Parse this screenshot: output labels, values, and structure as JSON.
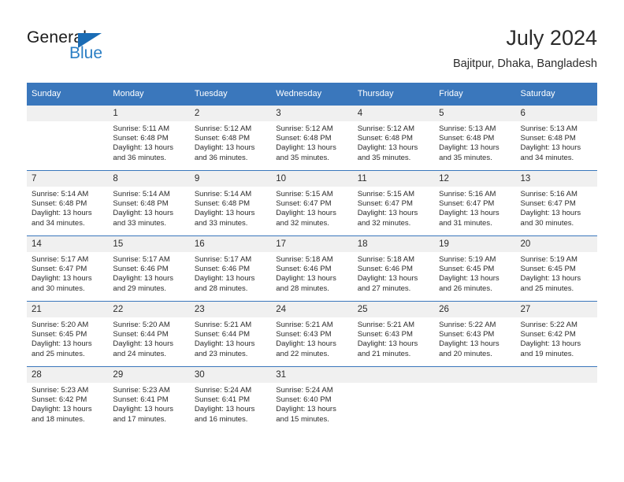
{
  "brand": {
    "name_part1": "General",
    "name_part2": "Blue",
    "triangle_icon": "triangle-icon",
    "accent_color": "#1a6cb5",
    "text_color": "#2a7ec4"
  },
  "header": {
    "title": "July 2024",
    "subtitle": "Bajitpur, Dhaka, Bangladesh"
  },
  "calendar": {
    "header_bg": "#3a77bc",
    "daynum_bg": "#f0f0f0",
    "weekday_headers": [
      "Sunday",
      "Monday",
      "Tuesday",
      "Wednesday",
      "Thursday",
      "Friday",
      "Saturday"
    ],
    "weeks": [
      [
        {
          "day": "",
          "empty": true
        },
        {
          "day": "1",
          "sunrise": "Sunrise: 5:11 AM",
          "sunset": "Sunset: 6:48 PM",
          "daylight_line1": "Daylight: 13 hours",
          "daylight_line2": "and 36 minutes."
        },
        {
          "day": "2",
          "sunrise": "Sunrise: 5:12 AM",
          "sunset": "Sunset: 6:48 PM",
          "daylight_line1": "Daylight: 13 hours",
          "daylight_line2": "and 36 minutes."
        },
        {
          "day": "3",
          "sunrise": "Sunrise: 5:12 AM",
          "sunset": "Sunset: 6:48 PM",
          "daylight_line1": "Daylight: 13 hours",
          "daylight_line2": "and 35 minutes."
        },
        {
          "day": "4",
          "sunrise": "Sunrise: 5:12 AM",
          "sunset": "Sunset: 6:48 PM",
          "daylight_line1": "Daylight: 13 hours",
          "daylight_line2": "and 35 minutes."
        },
        {
          "day": "5",
          "sunrise": "Sunrise: 5:13 AM",
          "sunset": "Sunset: 6:48 PM",
          "daylight_line1": "Daylight: 13 hours",
          "daylight_line2": "and 35 minutes."
        },
        {
          "day": "6",
          "sunrise": "Sunrise: 5:13 AM",
          "sunset": "Sunset: 6:48 PM",
          "daylight_line1": "Daylight: 13 hours",
          "daylight_line2": "and 34 minutes."
        }
      ],
      [
        {
          "day": "7",
          "sunrise": "Sunrise: 5:14 AM",
          "sunset": "Sunset: 6:48 PM",
          "daylight_line1": "Daylight: 13 hours",
          "daylight_line2": "and 34 minutes."
        },
        {
          "day": "8",
          "sunrise": "Sunrise: 5:14 AM",
          "sunset": "Sunset: 6:48 PM",
          "daylight_line1": "Daylight: 13 hours",
          "daylight_line2": "and 33 minutes."
        },
        {
          "day": "9",
          "sunrise": "Sunrise: 5:14 AM",
          "sunset": "Sunset: 6:48 PM",
          "daylight_line1": "Daylight: 13 hours",
          "daylight_line2": "and 33 minutes."
        },
        {
          "day": "10",
          "sunrise": "Sunrise: 5:15 AM",
          "sunset": "Sunset: 6:47 PM",
          "daylight_line1": "Daylight: 13 hours",
          "daylight_line2": "and 32 minutes."
        },
        {
          "day": "11",
          "sunrise": "Sunrise: 5:15 AM",
          "sunset": "Sunset: 6:47 PM",
          "daylight_line1": "Daylight: 13 hours",
          "daylight_line2": "and 32 minutes."
        },
        {
          "day": "12",
          "sunrise": "Sunrise: 5:16 AM",
          "sunset": "Sunset: 6:47 PM",
          "daylight_line1": "Daylight: 13 hours",
          "daylight_line2": "and 31 minutes."
        },
        {
          "day": "13",
          "sunrise": "Sunrise: 5:16 AM",
          "sunset": "Sunset: 6:47 PM",
          "daylight_line1": "Daylight: 13 hours",
          "daylight_line2": "and 30 minutes."
        }
      ],
      [
        {
          "day": "14",
          "sunrise": "Sunrise: 5:17 AM",
          "sunset": "Sunset: 6:47 PM",
          "daylight_line1": "Daylight: 13 hours",
          "daylight_line2": "and 30 minutes."
        },
        {
          "day": "15",
          "sunrise": "Sunrise: 5:17 AM",
          "sunset": "Sunset: 6:46 PM",
          "daylight_line1": "Daylight: 13 hours",
          "daylight_line2": "and 29 minutes."
        },
        {
          "day": "16",
          "sunrise": "Sunrise: 5:17 AM",
          "sunset": "Sunset: 6:46 PM",
          "daylight_line1": "Daylight: 13 hours",
          "daylight_line2": "and 28 minutes."
        },
        {
          "day": "17",
          "sunrise": "Sunrise: 5:18 AM",
          "sunset": "Sunset: 6:46 PM",
          "daylight_line1": "Daylight: 13 hours",
          "daylight_line2": "and 28 minutes."
        },
        {
          "day": "18",
          "sunrise": "Sunrise: 5:18 AM",
          "sunset": "Sunset: 6:46 PM",
          "daylight_line1": "Daylight: 13 hours",
          "daylight_line2": "and 27 minutes."
        },
        {
          "day": "19",
          "sunrise": "Sunrise: 5:19 AM",
          "sunset": "Sunset: 6:45 PM",
          "daylight_line1": "Daylight: 13 hours",
          "daylight_line2": "and 26 minutes."
        },
        {
          "day": "20",
          "sunrise": "Sunrise: 5:19 AM",
          "sunset": "Sunset: 6:45 PM",
          "daylight_line1": "Daylight: 13 hours",
          "daylight_line2": "and 25 minutes."
        }
      ],
      [
        {
          "day": "21",
          "sunrise": "Sunrise: 5:20 AM",
          "sunset": "Sunset: 6:45 PM",
          "daylight_line1": "Daylight: 13 hours",
          "daylight_line2": "and 25 minutes."
        },
        {
          "day": "22",
          "sunrise": "Sunrise: 5:20 AM",
          "sunset": "Sunset: 6:44 PM",
          "daylight_line1": "Daylight: 13 hours",
          "daylight_line2": "and 24 minutes."
        },
        {
          "day": "23",
          "sunrise": "Sunrise: 5:21 AM",
          "sunset": "Sunset: 6:44 PM",
          "daylight_line1": "Daylight: 13 hours",
          "daylight_line2": "and 23 minutes."
        },
        {
          "day": "24",
          "sunrise": "Sunrise: 5:21 AM",
          "sunset": "Sunset: 6:43 PM",
          "daylight_line1": "Daylight: 13 hours",
          "daylight_line2": "and 22 minutes."
        },
        {
          "day": "25",
          "sunrise": "Sunrise: 5:21 AM",
          "sunset": "Sunset: 6:43 PM",
          "daylight_line1": "Daylight: 13 hours",
          "daylight_line2": "and 21 minutes."
        },
        {
          "day": "26",
          "sunrise": "Sunrise: 5:22 AM",
          "sunset": "Sunset: 6:43 PM",
          "daylight_line1": "Daylight: 13 hours",
          "daylight_line2": "and 20 minutes."
        },
        {
          "day": "27",
          "sunrise": "Sunrise: 5:22 AM",
          "sunset": "Sunset: 6:42 PM",
          "daylight_line1": "Daylight: 13 hours",
          "daylight_line2": "and 19 minutes."
        }
      ],
      [
        {
          "day": "28",
          "sunrise": "Sunrise: 5:23 AM",
          "sunset": "Sunset: 6:42 PM",
          "daylight_line1": "Daylight: 13 hours",
          "daylight_line2": "and 18 minutes."
        },
        {
          "day": "29",
          "sunrise": "Sunrise: 5:23 AM",
          "sunset": "Sunset: 6:41 PM",
          "daylight_line1": "Daylight: 13 hours",
          "daylight_line2": "and 17 minutes."
        },
        {
          "day": "30",
          "sunrise": "Sunrise: 5:24 AM",
          "sunset": "Sunset: 6:41 PM",
          "daylight_line1": "Daylight: 13 hours",
          "daylight_line2": "and 16 minutes."
        },
        {
          "day": "31",
          "sunrise": "Sunrise: 5:24 AM",
          "sunset": "Sunset: 6:40 PM",
          "daylight_line1": "Daylight: 13 hours",
          "daylight_line2": "and 15 minutes."
        },
        {
          "day": "",
          "empty": true
        },
        {
          "day": "",
          "empty": true
        },
        {
          "day": "",
          "empty": true
        }
      ]
    ]
  }
}
